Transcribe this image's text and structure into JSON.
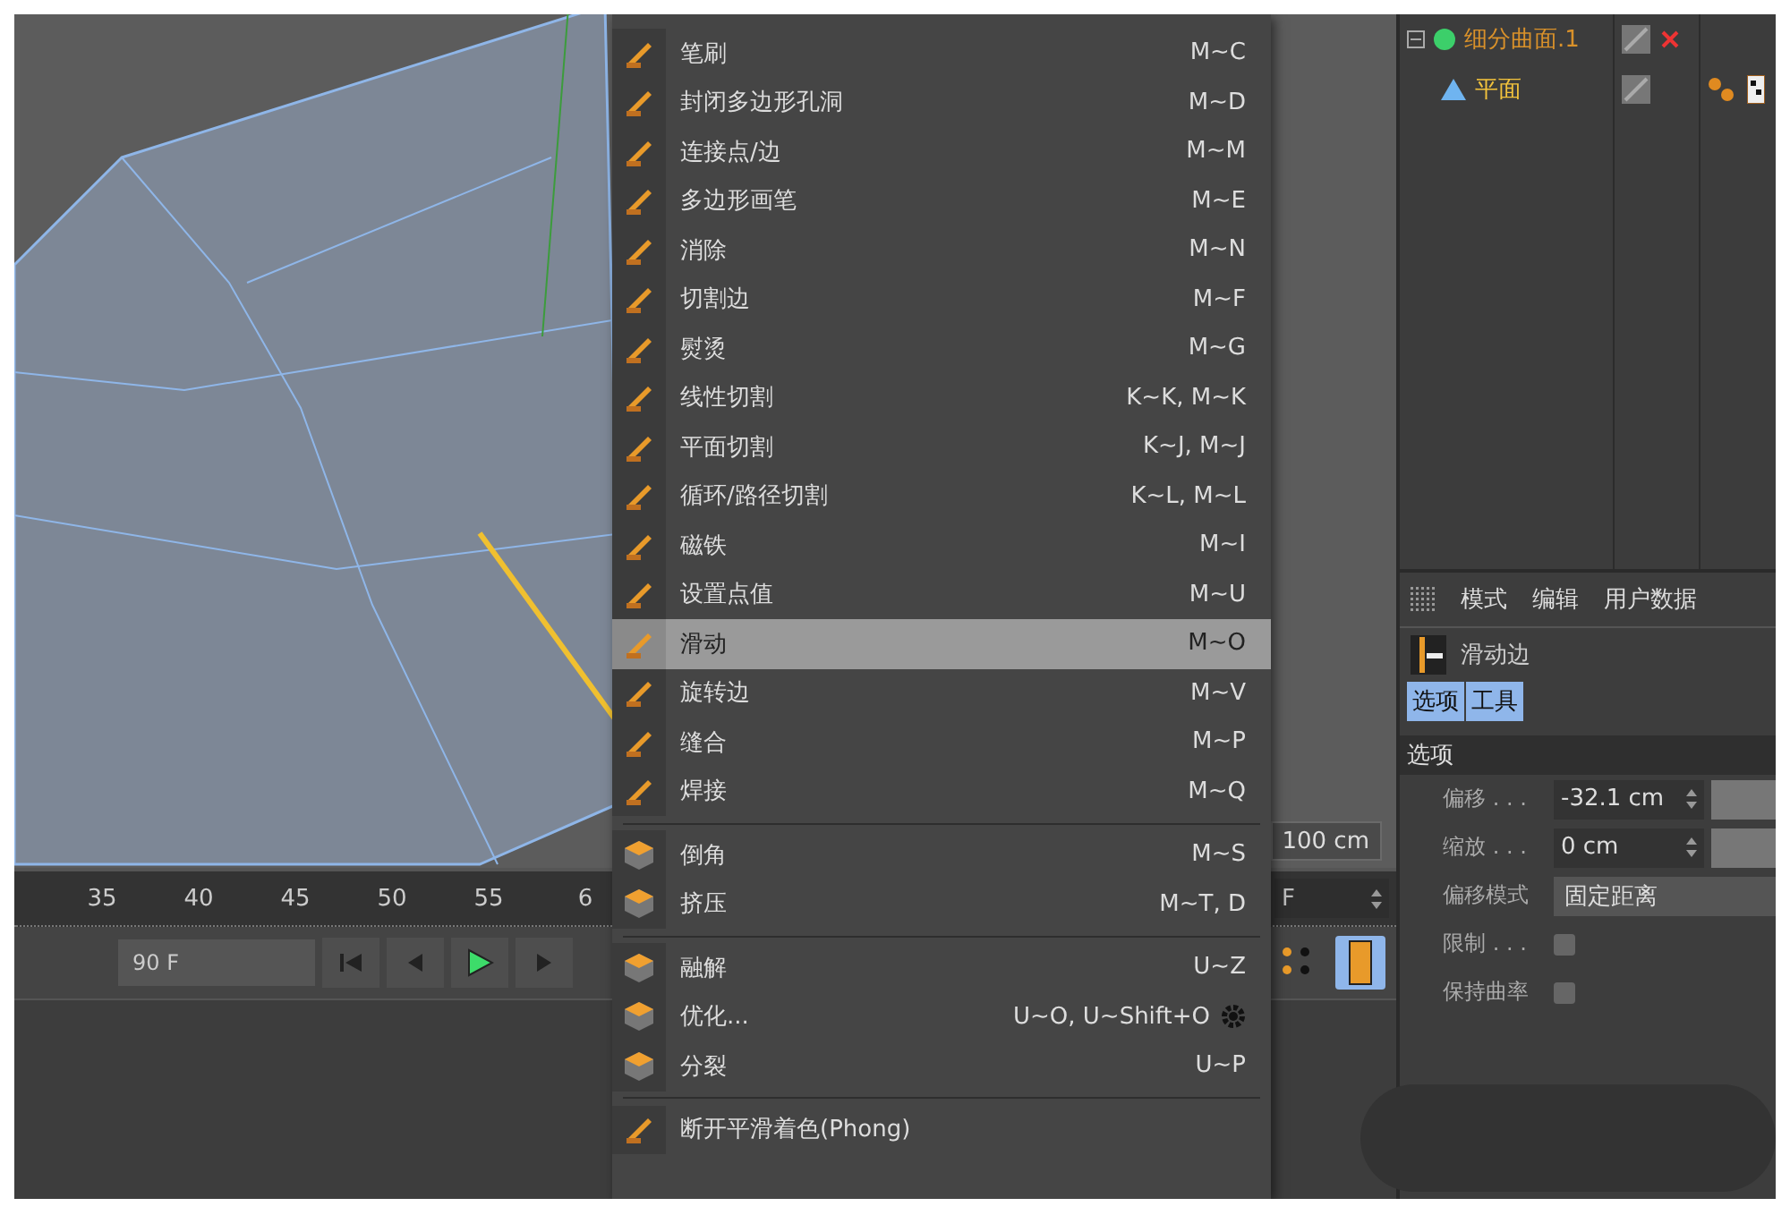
{
  "viewport": {
    "scale_field": "100 cm"
  },
  "timeline": {
    "ticks": [
      "35",
      "40",
      "45",
      "50",
      "55",
      "6"
    ],
    "end_field": "90 F",
    "frame_field": "F"
  },
  "menu": {
    "groups": [
      {
        "items": [
          {
            "label": "笔刷",
            "shortcut": "M~C",
            "selected": false,
            "has_options": false
          },
          {
            "label": "封闭多边形孔洞",
            "shortcut": "M~D",
            "selected": false,
            "has_options": false
          },
          {
            "label": "连接点/边",
            "shortcut": "M~M",
            "selected": false,
            "has_options": false
          },
          {
            "label": "多边形画笔",
            "shortcut": "M~E",
            "selected": false,
            "has_options": false
          },
          {
            "label": "消除",
            "shortcut": "M~N",
            "selected": false,
            "has_options": false
          },
          {
            "label": "切割边",
            "shortcut": "M~F",
            "selected": false,
            "has_options": false
          },
          {
            "label": "熨烫",
            "shortcut": "M~G",
            "selected": false,
            "has_options": false
          },
          {
            "label": "线性切割",
            "shortcut": "K~K, M~K",
            "selected": false,
            "has_options": false
          },
          {
            "label": "平面切割",
            "shortcut": "K~J, M~J",
            "selected": false,
            "has_options": false
          },
          {
            "label": "循环/路径切割",
            "shortcut": "K~L, M~L",
            "selected": false,
            "has_options": false
          },
          {
            "label": "磁铁",
            "shortcut": "M~I",
            "selected": false,
            "has_options": false
          },
          {
            "label": "设置点值",
            "shortcut": "M~U",
            "selected": false,
            "has_options": false
          },
          {
            "label": "滑动",
            "shortcut": "M~O",
            "selected": true,
            "has_options": false
          },
          {
            "label": "旋转边",
            "shortcut": "M~V",
            "selected": false,
            "has_options": false
          },
          {
            "label": "缝合",
            "shortcut": "M~P",
            "selected": false,
            "has_options": false
          },
          {
            "label": "焊接",
            "shortcut": "M~Q",
            "selected": false,
            "has_options": false
          }
        ]
      },
      {
        "items": [
          {
            "label": "倒角",
            "shortcut": "M~S",
            "selected": false,
            "has_options": false
          },
          {
            "label": "挤压",
            "shortcut": "M~T, D",
            "selected": false,
            "has_options": false
          }
        ]
      },
      {
        "items": [
          {
            "label": "融解",
            "shortcut": "U~Z",
            "selected": false,
            "has_options": false
          },
          {
            "label": "优化...",
            "shortcut": "U~O, U~Shift+O",
            "selected": false,
            "has_options": true
          },
          {
            "label": "分裂",
            "shortcut": "U~P",
            "selected": false,
            "has_options": false
          }
        ]
      },
      {
        "items": [
          {
            "label": "断开平滑着色(Phong)",
            "selected": false,
            "has_options": false
          }
        ]
      }
    ]
  },
  "objects": [
    {
      "name": "细分曲面.1",
      "expanded": true,
      "children": [
        {
          "name": "平面"
        }
      ]
    }
  ],
  "attributes": {
    "menu": [
      "模式",
      "编辑",
      "用户数据"
    ],
    "tool_title": "滑动边",
    "tabs": [
      {
        "label": "选项",
        "selected": true
      },
      {
        "label": "工具",
        "selected": true
      }
    ],
    "section": "选项",
    "fields": [
      {
        "kind": "number",
        "label": "偏移 . . .",
        "value": "-32.1 cm",
        "level": 1
      },
      {
        "kind": "number",
        "label": "缩放 . . .",
        "value": "0 cm",
        "level": 1
      },
      {
        "kind": "dropdown",
        "label": "偏移模式",
        "value": "固定距离"
      },
      {
        "kind": "checkbox",
        "label": "限制 . . .",
        "checked": false
      },
      {
        "kind": "checkbox",
        "label": "保持曲率",
        "checked": false
      }
    ]
  }
}
